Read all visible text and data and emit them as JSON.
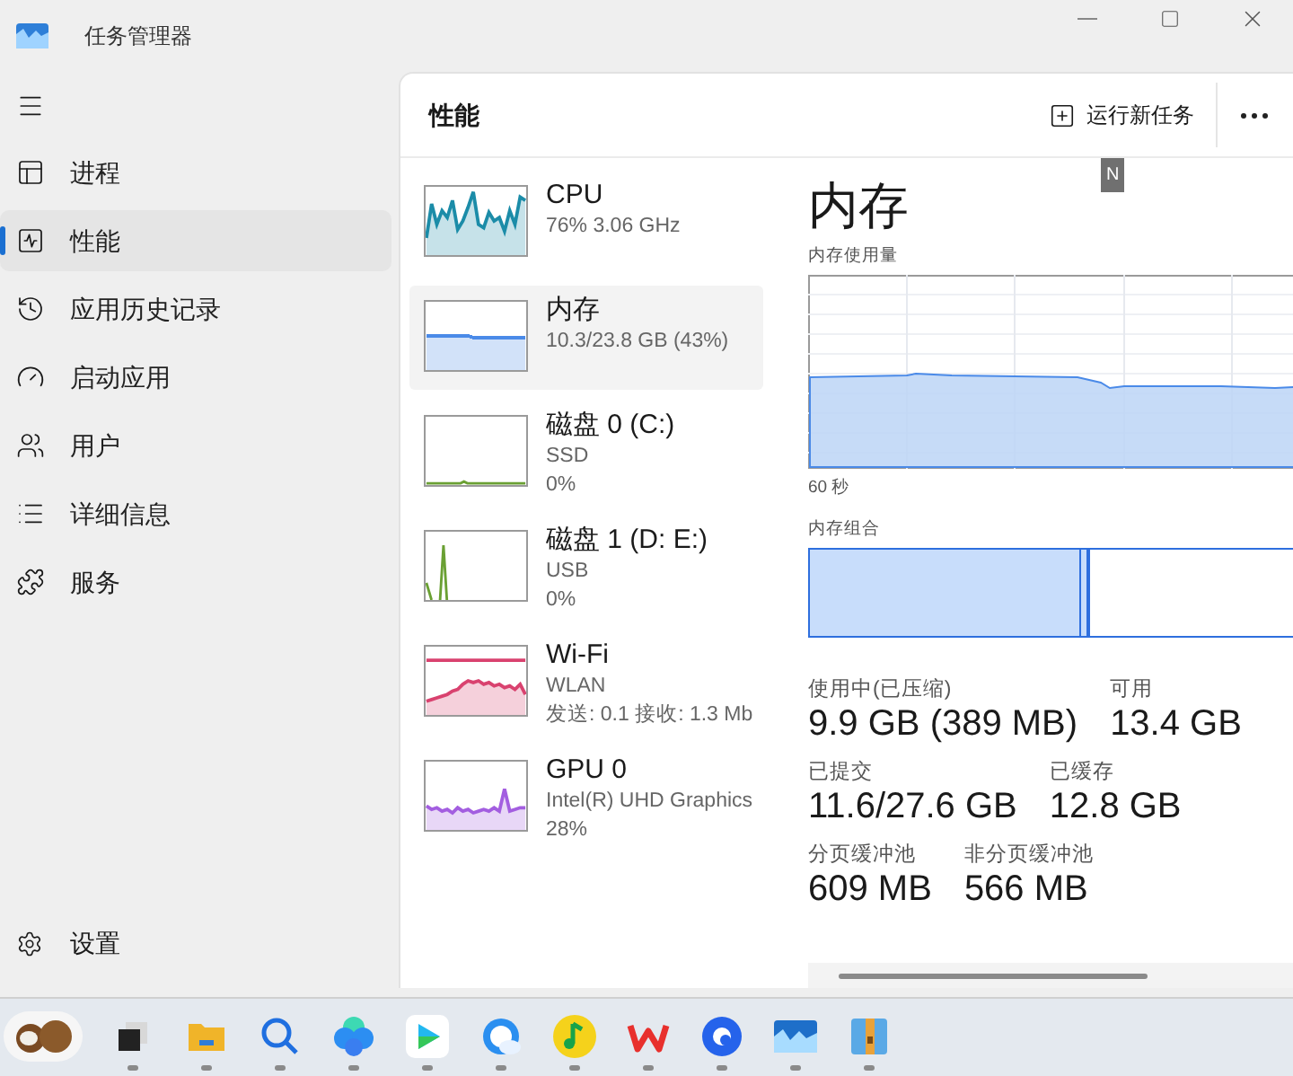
{
  "window": {
    "title": "任务管理器"
  },
  "sidebar": {
    "items": [
      {
        "label": "进程",
        "selected": false
      },
      {
        "label": "性能",
        "selected": true
      },
      {
        "label": "应用历史记录",
        "selected": false
      },
      {
        "label": "启动应用",
        "selected": false
      },
      {
        "label": "用户",
        "selected": false
      },
      {
        "label": "详细信息",
        "selected": false
      },
      {
        "label": "服务",
        "selected": false
      }
    ],
    "settings": "设置"
  },
  "header": {
    "title": "性能",
    "run_task": "运行新任务",
    "tooltip": "N"
  },
  "devices": [
    {
      "kind": "cpu",
      "name": "CPU",
      "lines": [
        "76%  3.06 GHz"
      ],
      "color": "#1b8ca8",
      "selected": false
    },
    {
      "kind": "memory",
      "name": "内存",
      "lines": [
        "10.3/23.8 GB (43%)"
      ],
      "color": "#4a8ae8",
      "selected": true
    },
    {
      "kind": "disk",
      "name": "磁盘 0 (C:)",
      "lines": [
        "SSD",
        "0%"
      ],
      "color": "#6aa033",
      "selected": false
    },
    {
      "kind": "disk",
      "name": "磁盘 1 (D: E:)",
      "lines": [
        "USB",
        "0%"
      ],
      "color": "#6aa033",
      "selected": false
    },
    {
      "kind": "network",
      "name": "Wi-Fi",
      "lines": [
        "WLAN",
        "发送: 0.1  接收: 1.3 Mb"
      ],
      "color": "#d9426f",
      "selected": false
    },
    {
      "kind": "gpu",
      "name": "GPU 0",
      "lines": [
        "Intel(R) UHD Graphics",
        "28%"
      ],
      "color": "#a35ee0",
      "selected": false
    }
  ],
  "detail": {
    "title": "内存",
    "usage_label": "内存使用量",
    "time_label": "60 秒",
    "composition_label": "内存组合",
    "composition": {
      "level": 0.56
    },
    "stats": [
      [
        {
          "label": "使用中(已压缩)",
          "value": "9.9 GB (389 MB)"
        },
        {
          "label": "可用",
          "value": "13.4 GB"
        }
      ],
      [
        {
          "label": "已提交",
          "value": "11.6/27.6 GB"
        },
        {
          "label": "已缓存",
          "value": "12.8 GB"
        }
      ],
      [
        {
          "label": "分页缓冲池",
          "value": "609 MB"
        },
        {
          "label": "非分页缓冲池",
          "value": "566 MB"
        }
      ]
    ]
  }
}
